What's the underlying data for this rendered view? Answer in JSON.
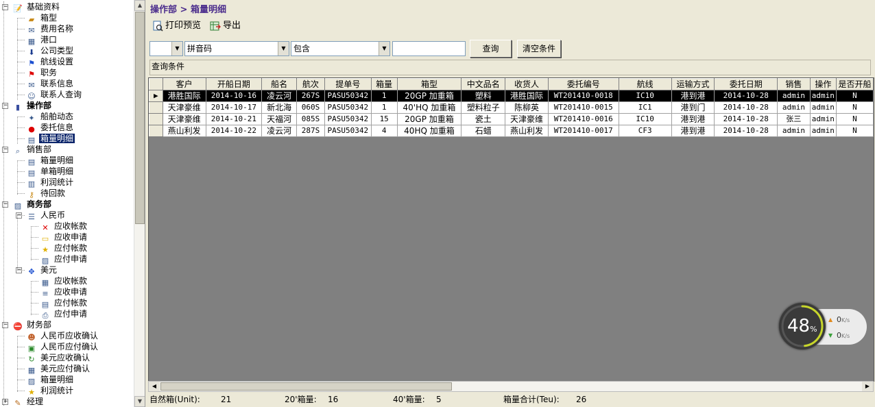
{
  "tree": {
    "items": [
      {
        "label": "基础资料",
        "icon": "notepad-icon",
        "level": 0,
        "bold": false,
        "expander": "−"
      },
      {
        "label": "箱型",
        "icon": "container-icon",
        "level": 1
      },
      {
        "label": "费用名称",
        "icon": "envelope-icon",
        "level": 1
      },
      {
        "label": "港口",
        "icon": "spreadsheet-icon",
        "level": 1
      },
      {
        "label": "公司类型",
        "icon": "download-icon",
        "level": 1
      },
      {
        "label": "航线设置",
        "icon": "blue-flag-icon",
        "level": 1
      },
      {
        "label": "职务",
        "icon": "red-flag-icon",
        "level": 1
      },
      {
        "label": "联系信息",
        "icon": "mail-icon",
        "level": 1
      },
      {
        "label": "联系人查询",
        "icon": "contact-icon",
        "level": 1
      },
      {
        "label": "操作部",
        "icon": "book-icon",
        "level": 0,
        "bold": true,
        "expander": "−"
      },
      {
        "label": "船舶动态",
        "icon": "satellite-icon",
        "level": 1
      },
      {
        "label": "委托信息",
        "icon": "apple-icon",
        "level": 1
      },
      {
        "label": "箱量明细",
        "icon": "document-icon",
        "level": 1,
        "selected": true
      },
      {
        "label": "销售部",
        "icon": "magnifier-icon",
        "level": 0,
        "bold": false,
        "expander": "−"
      },
      {
        "label": "箱量明细",
        "icon": "document-icon",
        "level": 1
      },
      {
        "label": "单箱明细",
        "icon": "document-icon",
        "level": 1
      },
      {
        "label": "利润统计",
        "icon": "chart-doc-icon",
        "level": 1
      },
      {
        "label": "待回款",
        "icon": "key-icon",
        "level": 1
      },
      {
        "label": "商务部",
        "icon": "chart-icon",
        "level": 0,
        "bold": true,
        "expander": "−"
      },
      {
        "label": "人民币",
        "icon": "list-icon",
        "level": 1,
        "expander": "−"
      },
      {
        "label": "应收帐款",
        "icon": "red-x-icon",
        "level": 2
      },
      {
        "label": "应收申请",
        "icon": "folder-icon",
        "level": 2
      },
      {
        "label": "应付帐款",
        "icon": "star-icon",
        "level": 2
      },
      {
        "label": "应付申请",
        "icon": "chart-icon",
        "level": 2
      },
      {
        "label": "美元",
        "icon": "cursor-move-icon",
        "level": 1,
        "expander": "−"
      },
      {
        "label": "应收帐款",
        "icon": "table-icon",
        "level": 2
      },
      {
        "label": "应收申请",
        "icon": "numbered-list-icon",
        "level": 2
      },
      {
        "label": "应付帐款",
        "icon": "document-icon",
        "level": 2
      },
      {
        "label": "应付申请",
        "icon": "printer-icon",
        "level": 2
      },
      {
        "label": "财务部",
        "icon": "stop-icon",
        "level": 0,
        "bold": false,
        "expander": "−"
      },
      {
        "label": "人民币应收确认",
        "icon": "users-icon",
        "level": 1
      },
      {
        "label": "人民币应付确认",
        "icon": "calculator-icon",
        "level": 1
      },
      {
        "label": "美元应收确认",
        "icon": "refresh-icon",
        "level": 1
      },
      {
        "label": "美元应付确认",
        "icon": "table-icon",
        "level": 1
      },
      {
        "label": "箱量明细",
        "icon": "chart-icon",
        "level": 1
      },
      {
        "label": "利润统计",
        "icon": "star-icon",
        "level": 1
      },
      {
        "label": "经理",
        "icon": "pen-icon",
        "level": 0,
        "bold": false,
        "expander": "+"
      }
    ]
  },
  "breadcrumb": "操作部 > 箱量明细",
  "toolbar": {
    "print_preview_label": "打印预览",
    "export_label": "导出"
  },
  "filter": {
    "field1_value": "",
    "field2_value": "拼音码",
    "op_value": "包含",
    "keyword_value": "",
    "query_label": "查询",
    "clear_label": "清空条件",
    "conditions_label": "查询条件"
  },
  "grid": {
    "columns": [
      "客户",
      "开船日期",
      "船名",
      "航次",
      "提单号",
      "箱量",
      "箱型",
      "中文品名",
      "收货人",
      "委托编号",
      "航线",
      "运输方式",
      "委托日期",
      "销售",
      "操作",
      "是否开船"
    ],
    "rows": [
      [
        "港胜国际",
        "2014-10-16",
        "凌云河",
        "267S",
        "PASU50342",
        "1",
        "20GP 加重箱",
        "塑料",
        "港胜国际",
        "WT201410-0018",
        "IC10",
        "港到港",
        "2014-10-28",
        "admin",
        "admin",
        "N"
      ],
      [
        "天津豪维",
        "2014-10-17",
        "新北海",
        "060S",
        "PASU50342",
        "1",
        "40'HQ 加重箱",
        "塑料粒子",
        "陈柳英",
        "WT201410-0015",
        "IC1",
        "港到门",
        "2014-10-28",
        "admin",
        "admin",
        "N"
      ],
      [
        "天津豪维",
        "2014-10-21",
        "天福河",
        "085S",
        "PASU50342",
        "15",
        "20GP 加重箱",
        "瓷土",
        "天津豪维",
        "WT201410-0016",
        "IC10",
        "港到港",
        "2014-10-28",
        "张三",
        "admin",
        "N"
      ],
      [
        "燕山利发",
        "2014-10-22",
        "凌云河",
        "287S",
        "PASU50342",
        "4",
        "40HQ 加重箱",
        "石蜡",
        "燕山利发",
        "WT201410-0017",
        "CF3",
        "港到港",
        "2014-10-28",
        "admin",
        "admin",
        "N"
      ]
    ],
    "selected_row": 0
  },
  "status": {
    "natural_label": "自然箱(Unit):",
    "natural_value": "21",
    "c20_label": "20'箱量:",
    "c20_value": "16",
    "c40_label": "40'箱量:",
    "c40_value": "5",
    "teu_label": "箱量合计(Teu):",
    "teu_value": "26"
  },
  "speed_widget": {
    "percent": "48",
    "percent_unit": "%",
    "up_value": "0",
    "down_value": "0",
    "unit": "K/s"
  }
}
